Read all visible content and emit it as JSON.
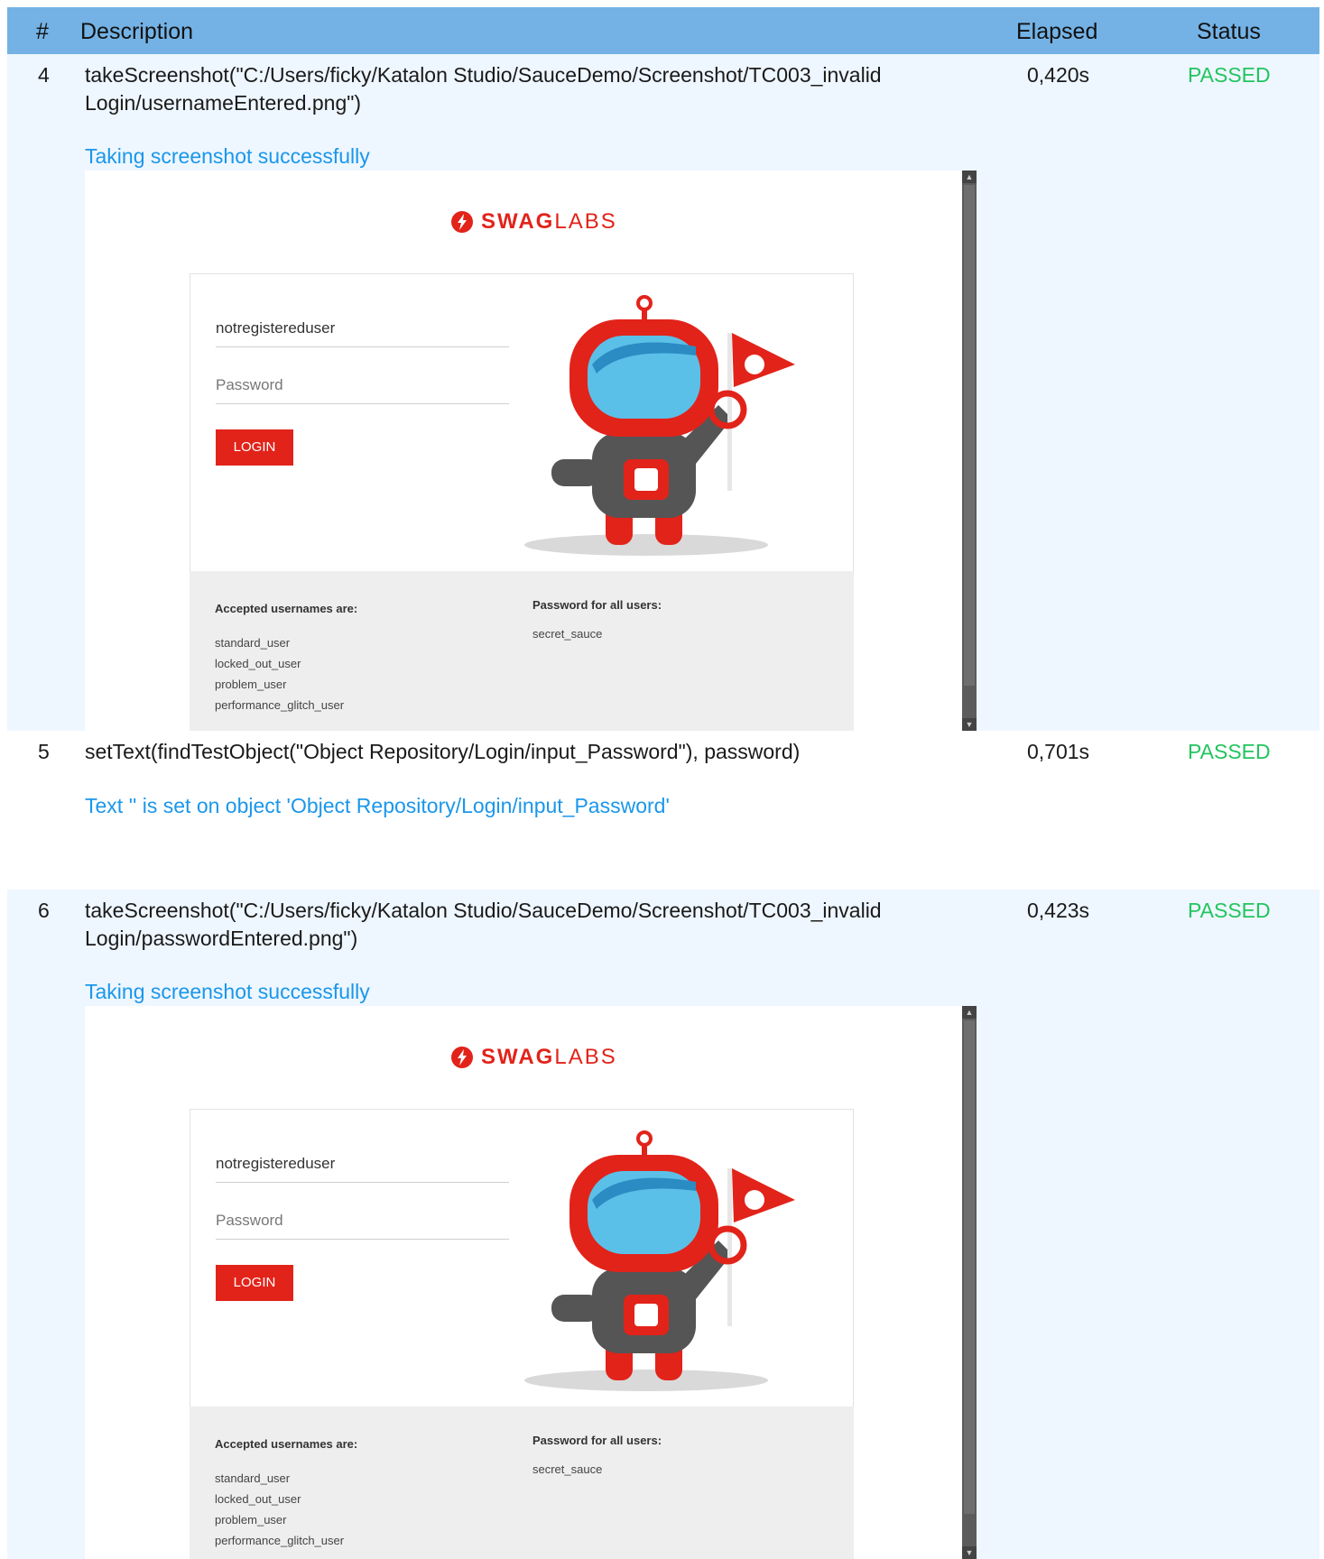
{
  "header": {
    "num": "#",
    "description": "Description",
    "elapsed": "Elapsed",
    "status": "Status"
  },
  "steps": [
    {
      "num": "4",
      "description": "takeScreenshot(\"C:/Users/ficky/Katalon Studio/SauceDemo/Screenshot/TC003_invalid Login/usernameEntered.png\")",
      "elapsed": "0,420s",
      "status": "PASSED",
      "message": "Taking screenshot successfully",
      "shot": {
        "username": "notregistereduser",
        "password_placeholder": "Password"
      }
    },
    {
      "num": "5",
      "description": "setText(findTestObject(\"Object Repository/Login/input_Password\"), password)",
      "elapsed": "0,701s",
      "status": "PASSED",
      "message": "Text '' is set on object 'Object Repository/Login/input_Password'"
    },
    {
      "num": "6",
      "description": "takeScreenshot(\"C:/Users/ficky/Katalon Studio/SauceDemo/Screenshot/TC003_invalid Login/passwordEntered.png\")",
      "elapsed": "0,423s",
      "status": "PASSED",
      "message": "Taking screenshot successfully",
      "shot": {
        "username": "notregistereduser",
        "password_placeholder": "Password"
      }
    }
  ],
  "swaglabs": {
    "logo_bold": "SWAG",
    "logo_light": "LABS",
    "login_label": "LOGIN",
    "accepted_title": "Accepted usernames are:",
    "usernames": [
      "standard_user",
      "locked_out_user",
      "problem_user",
      "performance_glitch_user"
    ],
    "password_title": "Password for all users:",
    "password_value": "secret_sauce"
  },
  "colors": {
    "header_bg": "#74b2e5",
    "row_bg": "#eef6ff",
    "passed": "#22c55e",
    "message": "#1a97ea",
    "brand_red": "#e2231a"
  }
}
